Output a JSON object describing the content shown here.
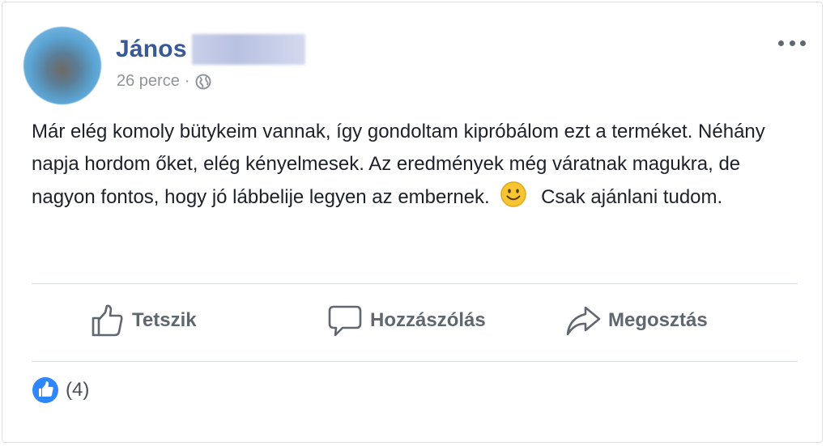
{
  "post": {
    "author": "János",
    "timestamp": "26 perce",
    "separator": "·",
    "privacy_icon": "globe-icon",
    "text_before_emoji": "Már elég komoly bütykeim vannak, így gondoltam kipróbálom ezt a terméket. Néhány napja hordom őket, elég kényelmesek. Az eredmények még váratnak magukra, de nagyon fontos, hogy jó lábbelije legyen az embernek.",
    "emoji": "smiling-face-icon",
    "text_after_emoji": "Csak ajánlani tudom."
  },
  "actions": {
    "like_label": "Tetszik",
    "comment_label": "Hozzászólás",
    "share_label": "Megosztás"
  },
  "reactions": {
    "count_label": "(4)"
  },
  "colors": {
    "author": "#385898",
    "meta": "#90949c",
    "text": "#1d2129",
    "action": "#606770",
    "like_blue": "#2d88ff",
    "divider": "#dadde1"
  }
}
